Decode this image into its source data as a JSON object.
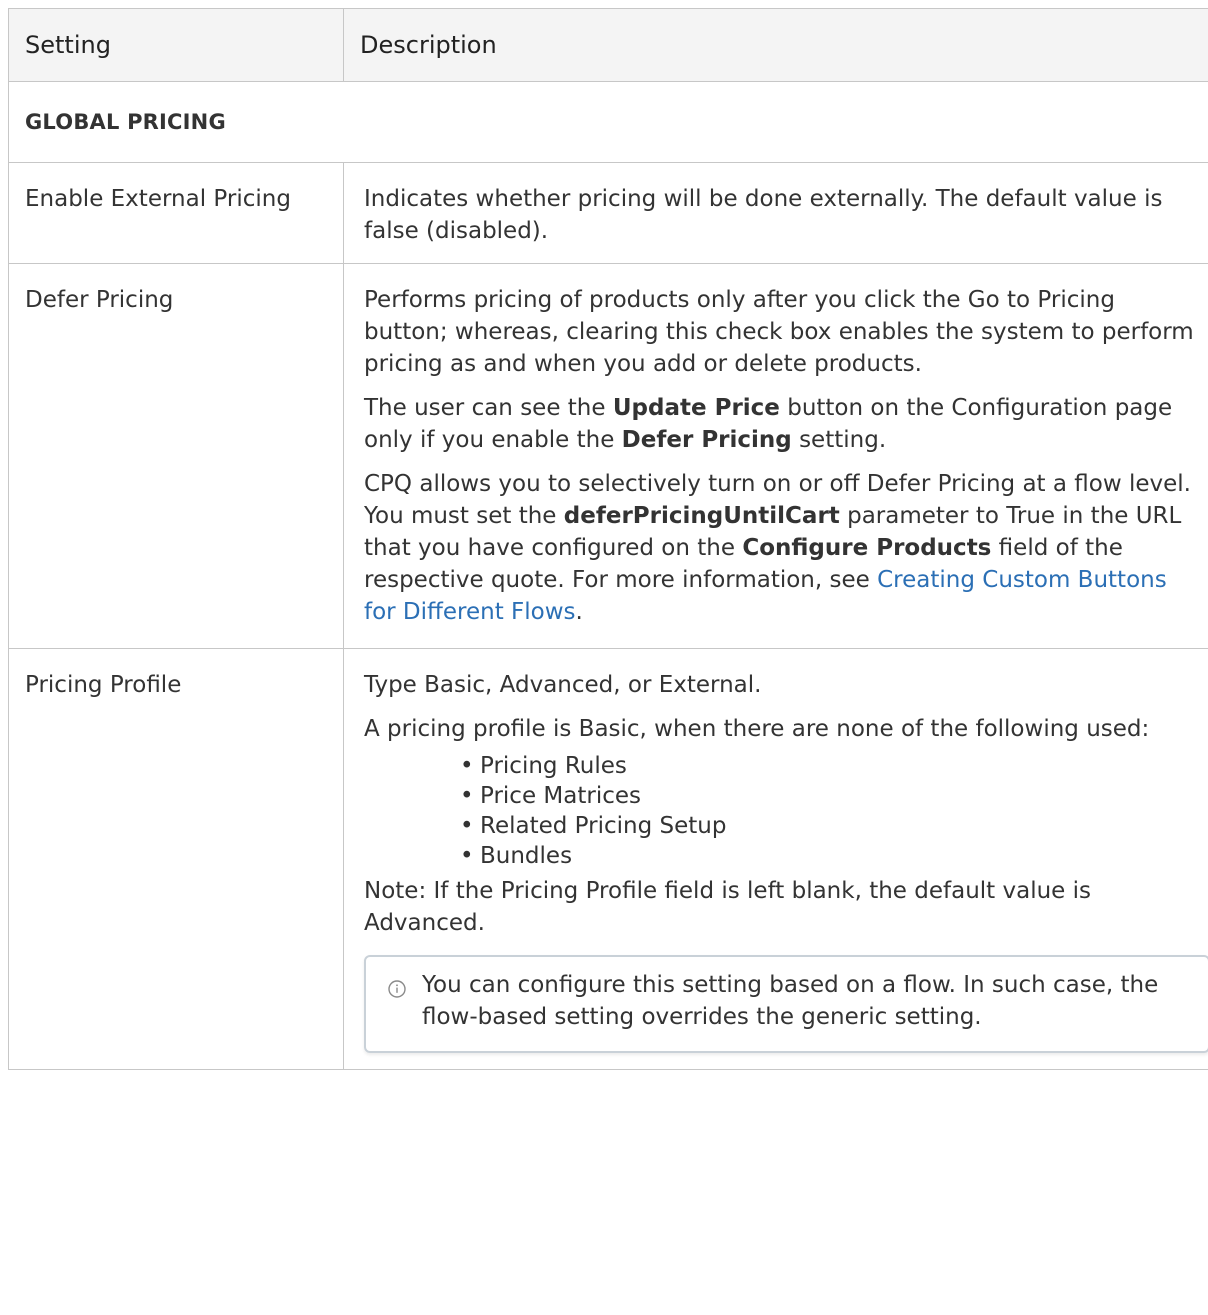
{
  "table": {
    "headers": {
      "setting": "Setting",
      "description": "Description"
    },
    "section": "GLOBAL PRICING",
    "rows": [
      {
        "setting": "Enable External Pricing",
        "desc": "Indicates whether pricing will be done externally. The default value is false (disabled)."
      },
      {
        "setting": "Defer Pricing",
        "p1": "Performs pricing of products only after you click the Go to Pricing button; whereas, clearing this check box enables the system to perform pricing as and when you add or delete products.",
        "p2": {
          "a": "The user can see the ",
          "b1": "Update Price",
          "c": " button on the Configuration page only if you enable the ",
          "b2": "Defer Pricing",
          "d": " setting."
        },
        "p3": {
          "a": "CPQ allows you to selectively turn on or off Defer Pricing at a flow level. You must set the ",
          "b1": "deferPricingUntilCart",
          "c": " parameter to True in the URL that you have configured on the ",
          "b2": "Configure Products",
          "d": " field of the respective quote. For more information, see ",
          "link": "Creating Custom Buttons for Different Flows",
          "e": "."
        }
      },
      {
        "setting": "Pricing Profile",
        "p1": "Type Basic, Advanced, or External.",
        "p2": "A pricing profile is Basic, when there are none of the following used:",
        "bullets": [
          "Pricing Rules",
          "Price Matrices",
          "Related Pricing Setup",
          "Bundles"
        ],
        "note": "Note: If the Pricing Profile field is left blank, the default value is Advanced.",
        "info": "You can configure this setting based on a flow. In such case, the flow-based setting overrides the generic setting."
      }
    ]
  },
  "colors": {
    "link": "#2b6fb5",
    "header_bg": "#f4f4f4",
    "border": "#c7c7c7"
  },
  "icons": {
    "info": "info-icon",
    "bullet": "•"
  }
}
